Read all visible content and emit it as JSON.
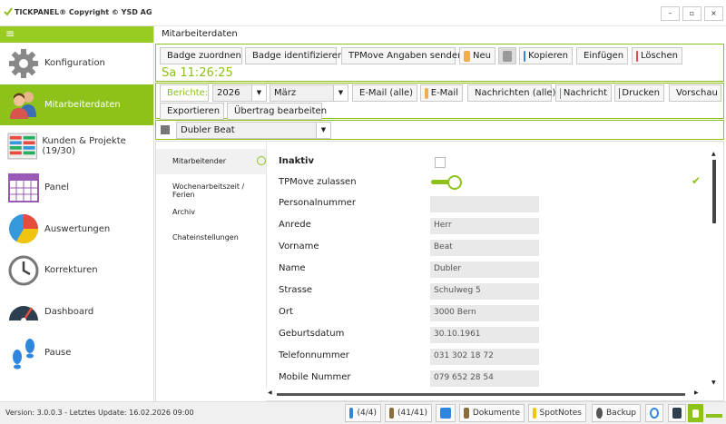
{
  "window": {
    "title": "TICKPANEL® Copyright © YSD AG",
    "minimize": "–",
    "maximize": "▫",
    "close": "×"
  },
  "sidebar": {
    "menu_glyph": "≡",
    "items": [
      {
        "label": "Konfiguration",
        "icon": "gear-icon"
      },
      {
        "label": "Mitarbeiterdaten",
        "icon": "users-icon"
      },
      {
        "label": "Kunden & Projekte (19/30)",
        "icon": "kanban-icon"
      },
      {
        "label": "Panel",
        "icon": "grid-icon"
      },
      {
        "label": "Auswertungen",
        "icon": "pie-chart-icon"
      },
      {
        "label": "Korrekturen",
        "icon": "clock-icon"
      },
      {
        "label": "Dashboard",
        "icon": "gauge-icon"
      },
      {
        "label": "Pause",
        "icon": "footprints-icon"
      }
    ]
  },
  "page": {
    "title": "Mitarbeiterdaten",
    "clock": "Sa 11:26:25"
  },
  "toolbar1": {
    "badge_assign": "Badge zuordnen",
    "badge_identify": "Badge identifizieren",
    "tpmove_send": "TPMove Angaben senden",
    "new": "Neu",
    "copy": "Kopieren",
    "paste": "Einfügen",
    "delete": "Löschen"
  },
  "toolbar2": {
    "reports_label": "Berichte:",
    "year": "2026",
    "month": "März",
    "email_all": "E-Mail (alle)",
    "email": "E-Mail",
    "messages_all": "Nachrichten (alle)",
    "message": "Nachricht",
    "print": "Drucken",
    "preview": "Vorschau",
    "export": "Exportieren",
    "transfer_edit": "Übertrag bearbeiten"
  },
  "employee_select": {
    "value": "Dubler Beat"
  },
  "subnav": [
    "Mitarbeitender",
    "Wochenarbeitszeit / Ferien",
    "Archiv",
    "Chateinstellungen"
  ],
  "form": {
    "inactive_label": "Inaktiv",
    "tpmove_label": "TPMove zulassen",
    "fields": [
      {
        "label": "Personalnummer",
        "value": ""
      },
      {
        "label": "Anrede",
        "value": "Herr"
      },
      {
        "label": "Vorname",
        "value": "Beat"
      },
      {
        "label": "Name",
        "value": "Dubler"
      },
      {
        "label": "Strasse",
        "value": "Schulweg 5"
      },
      {
        "label": "Ort",
        "value": "3000 Bern"
      },
      {
        "label": "Geburtsdatum",
        "value": "30.10.1961"
      },
      {
        "label": "Telefonnummer",
        "value": "031 302 18 72"
      },
      {
        "label": "Mobile Nummer",
        "value": "079 652 28 54"
      }
    ]
  },
  "statusbar": {
    "version": "Version: 3.0.0.3 - Letztes Update: 16.02.2026 09:00",
    "devices": "(4/4)",
    "users": "(41/41)",
    "documents": "Dokumente",
    "spotnotes": "SpotNotes",
    "backup": "Backup"
  },
  "colors": {
    "accent": "#8cc21a",
    "accent_light": "#99cc22"
  }
}
